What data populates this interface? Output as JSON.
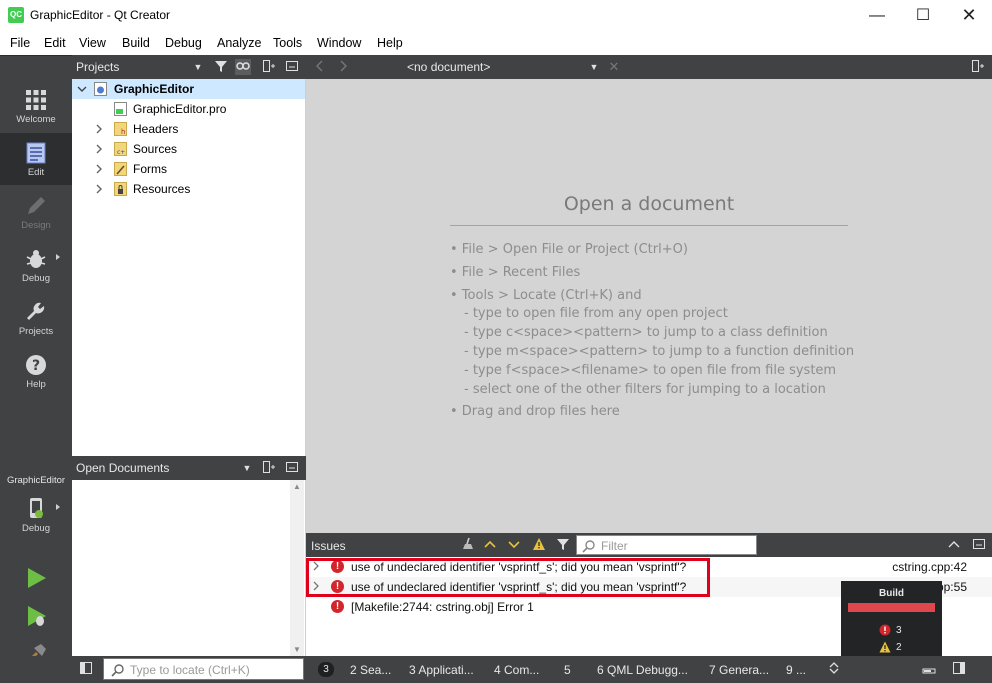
{
  "window": {
    "app_icon_text": "QC",
    "title": "GraphicEditor - Qt Creator",
    "minimize": "—",
    "maximize": "☐",
    "close": "✕"
  },
  "menu": [
    "File",
    "Edit",
    "View",
    "Build",
    "Debug",
    "Analyze",
    "Tools",
    "Window",
    "Help"
  ],
  "modes": [
    {
      "label": "Welcome",
      "icon": "grid-icon"
    },
    {
      "label": "Edit",
      "icon": "edit-document-icon",
      "active": true
    },
    {
      "label": "Design",
      "icon": "pencil-icon",
      "disabled": true
    },
    {
      "label": "Debug",
      "icon": "bug-icon"
    },
    {
      "label": "Projects",
      "icon": "wrench-icon"
    },
    {
      "label": "Help",
      "icon": "question-icon"
    }
  ],
  "kit": {
    "project": "GraphicEditor",
    "build_config": "Debug"
  },
  "projects_panel": {
    "title": "Projects",
    "tree": [
      {
        "label": "GraphicEditor",
        "type": "project",
        "expanded": true
      },
      {
        "label": "GraphicEditor.pro",
        "type": "pro-file"
      },
      {
        "label": "Headers",
        "type": "folder"
      },
      {
        "label": "Sources",
        "type": "folder"
      },
      {
        "label": "Forms",
        "type": "folder"
      },
      {
        "label": "Resources",
        "type": "folder"
      }
    ]
  },
  "open_documents": {
    "title": "Open Documents"
  },
  "editor": {
    "document_combo": "<no document>",
    "title": "Open a document",
    "hints": [
      "• File > Open File or Project (Ctrl+O)",
      "• File > Recent Files",
      "• Tools > Locate (Ctrl+K) and",
      "- type to open file from any open project",
      "- type c<space><pattern> to jump to a class definition",
      "- type m<space><pattern> to jump to a function definition",
      "- type f<space><filename> to open file from file system",
      "- select one of the other filters for jumping to a location",
      "• Drag and drop files here"
    ]
  },
  "issues": {
    "title": "Issues",
    "filter_placeholder": "Filter",
    "rows": [
      {
        "text": "use of undeclared identifier 'vsprintf_s'; did you mean 'vsprintf'?",
        "location": "cstring.cpp:42",
        "expandable": true
      },
      {
        "text": "use of undeclared identifier 'vsprintf_s'; did you mean 'vsprintf'?",
        "location": "cstring.cpp:55",
        "expandable": true
      },
      {
        "text": "[Makefile:2744: cstring.obj] Error 1",
        "location": "",
        "expandable": false
      }
    ]
  },
  "build_popup": {
    "title": "Build",
    "errors": "3",
    "warnings": "2",
    "progress": 1.0,
    "status_color": "#e0474c"
  },
  "statusbar": {
    "locate_placeholder": "Type to locate (Ctrl+K)",
    "badge": "3",
    "tabs": [
      "2  Sea...",
      "3  Applicati...",
      "4  Com...",
      "5",
      "6  QML Debugg...",
      "7  Genera...",
      "9  ..."
    ]
  },
  "colors": {
    "accent": "#41cd52",
    "error": "#d2262c",
    "highlight_box": "#e0001b",
    "selection": "#cde8ff"
  }
}
